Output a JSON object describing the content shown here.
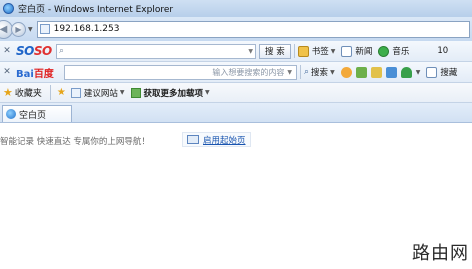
{
  "window": {
    "title": "空白页 - Windows Internet Explorer"
  },
  "address_bar": {
    "url": "192.168.1.253"
  },
  "soso_toolbar": {
    "logo_part1": "SO",
    "logo_part2": "SO",
    "search_button": "搜 索",
    "items": [
      {
        "label": "书签",
        "icon": "bookmark-icon"
      },
      {
        "label": "新闻",
        "icon": "news-icon"
      },
      {
        "label": "音乐",
        "icon": "music-icon"
      }
    ],
    "trailing_value": "10"
  },
  "baidu_toolbar": {
    "logo_part1": "Bai",
    "logo_part2": "百度",
    "placeholder": "输入想要搜索的内容",
    "search_button": "搜索",
    "last_item": "搜藏"
  },
  "favorites_bar": {
    "favorites_label": "收藏夹",
    "links": [
      {
        "label": "建议网站"
      },
      {
        "label": "获取更多加载项"
      }
    ]
  },
  "tabs": [
    {
      "label": "空白页"
    }
  ],
  "content": {
    "tagline": "智能记录 快速直达 专属你的上网导航！",
    "enable_link": "启用起始页"
  },
  "watermark": {
    "text": "路由网"
  }
}
